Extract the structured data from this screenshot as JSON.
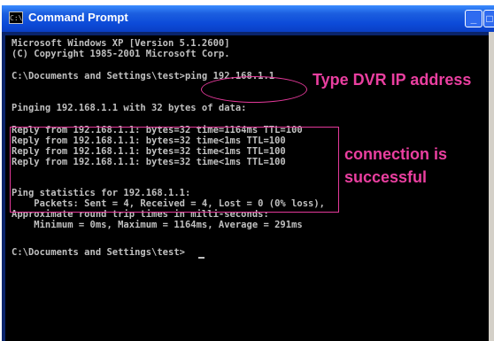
{
  "window": {
    "title": "Command Prompt",
    "icon": "cmd-icon",
    "title_icon_glyph": "C:\\",
    "controls": {
      "minimize": "_",
      "maximize": "□"
    }
  },
  "console": {
    "lines": [
      "Microsoft Windows XP [Version 5.1.2600]",
      "(C) Copyright 1985-2001 Microsoft Corp.",
      "",
      "C:\\Documents and Settings\\test>ping 192.168.1.1",
      "",
      "Pinging 192.168.1.1 with 32 bytes of data:",
      "",
      "Reply from 192.168.1.1: bytes=32 time=1164ms TTL=100",
      "Reply from 192.168.1.1: bytes=32 time<1ms TTL=100",
      "Reply from 192.168.1.1: bytes=32 time<1ms TTL=100",
      "Reply from 192.168.1.1: bytes=32 time<1ms TTL=100",
      "",
      "Ping statistics for 192.168.1.1:",
      "    Packets: Sent = 4, Received = 4, Lost = 0 (0% loss),",
      "Approximate round trip times in milli-seconds:",
      "    Minimum = 0ms, Maximum = 1164ms, Average = 291ms",
      "",
      "C:\\Documents and Settings\\test>"
    ]
  },
  "annotations": {
    "ip_note": "Type DVR IP address",
    "success_note_line1": "connection is",
    "success_note_line2": "successful",
    "color": "#ea3fa0"
  }
}
